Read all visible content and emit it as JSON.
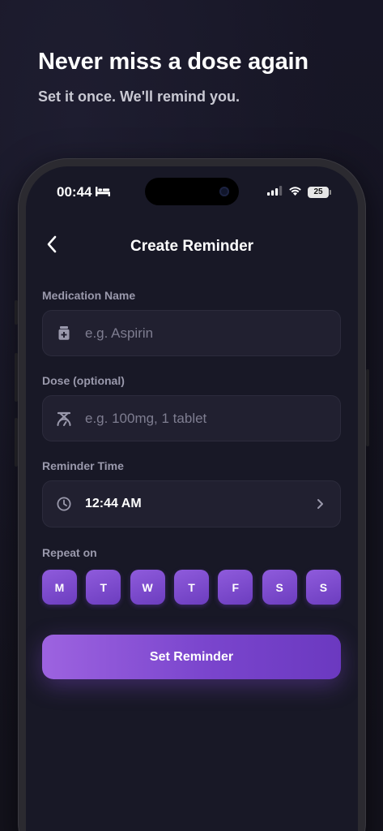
{
  "hero": {
    "title": "Never miss a dose again",
    "subtitle": "Set it once. We'll remind you."
  },
  "status_bar": {
    "time": "00:44",
    "battery": "25"
  },
  "header": {
    "title": "Create Reminder"
  },
  "form": {
    "medication": {
      "label": "Medication Name",
      "placeholder": "e.g. Aspirin",
      "value": ""
    },
    "dose": {
      "label": "Dose (optional)",
      "placeholder": "e.g. 100mg, 1 tablet",
      "value": ""
    },
    "reminder_time": {
      "label": "Reminder Time",
      "value": "12:44 AM"
    },
    "repeat": {
      "label": "Repeat on",
      "days": [
        "M",
        "T",
        "W",
        "T",
        "F",
        "S",
        "S"
      ]
    },
    "submit_label": "Set Reminder"
  },
  "colors": {
    "accent": "#8a52d8",
    "background": "#181826",
    "field": "#212030"
  }
}
